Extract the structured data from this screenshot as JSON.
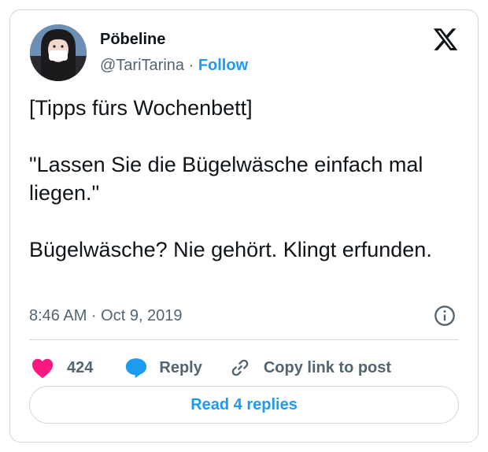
{
  "author": {
    "name": "Pöbeline",
    "handle": "@TariTarina",
    "separator": "·",
    "follow_label": "Follow"
  },
  "tweet": {
    "paragraphs": [
      "[Tipps fürs Wochenbett]",
      "\"Lassen Sie die Bügelwäsche einfach mal liegen.\"",
      "Bügelwäsche? Nie gehört. Klingt erfunden."
    ],
    "timestamp": "8:46 AM · Oct 9, 2019"
  },
  "actions": {
    "likes_count": "424",
    "reply_label": "Reply",
    "copy_link_label": "Copy link to post"
  },
  "footer": {
    "read_replies_label": "Read 4 replies"
  },
  "colors": {
    "accent": "#1d9bf0",
    "like": "#f91880",
    "muted": "#536471",
    "border": "#cfd9de"
  },
  "icons": {
    "logo": "x-logo-icon",
    "info": "info-icon",
    "like": "heart-icon",
    "reply": "speech-bubble-icon",
    "copy": "link-icon"
  }
}
